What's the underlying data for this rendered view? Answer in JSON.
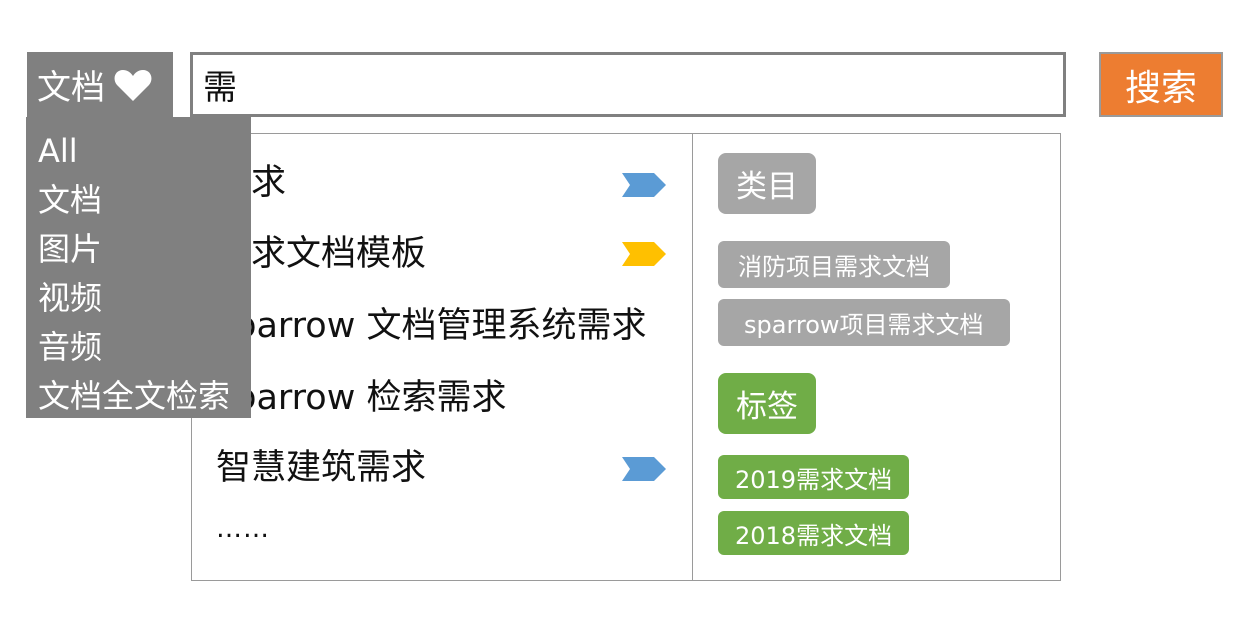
{
  "scope": {
    "selected": "文档",
    "options": [
      "All",
      "文档",
      "图片",
      "视频",
      "音频",
      "文档全文检索"
    ]
  },
  "search": {
    "query": "需",
    "button_label": "搜索"
  },
  "suggestions": [
    {
      "text": "需求",
      "tag": "arrow-blue"
    },
    {
      "text": "需求文档模板",
      "tag": "arrow-yellow"
    },
    {
      "text": "sparrow 文档管理系统需求",
      "tag": null
    },
    {
      "text": "sparrow 检索需求",
      "tag": null
    },
    {
      "text": "智慧建筑需求",
      "tag": "arrow-blue"
    }
  ],
  "more_text": "……",
  "categories": {
    "label": "类目",
    "items": [
      "消防项目需求文档",
      "sparrow项目需求文档"
    ]
  },
  "tags": {
    "label": "标签",
    "items": [
      "2019需求文档",
      "2018需求文档"
    ]
  },
  "colors": {
    "accent_orange": "#ed7d31",
    "scope_gray": "#808080",
    "chip_gray": "#a6a6a6",
    "chip_green": "#70ad47",
    "arrow_blue": "#5b9bd5",
    "arrow_yellow": "#ffc000"
  }
}
